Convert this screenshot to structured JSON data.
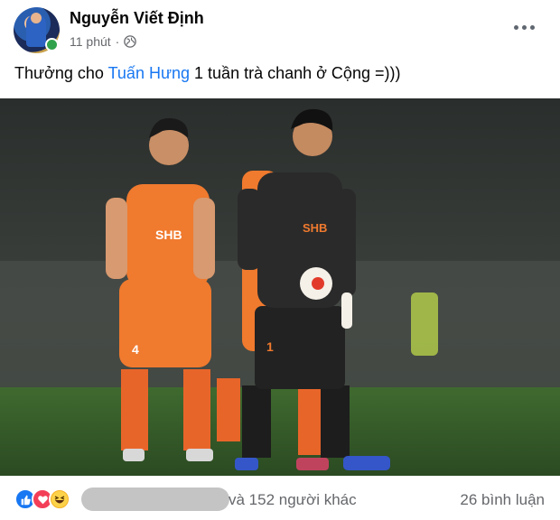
{
  "post": {
    "author": "Nguyễn Viết Định",
    "timestamp": "11 phút",
    "separator": "·",
    "privacy_icon": "globe-icon",
    "more_icon": "more-options-icon",
    "caption": {
      "before": "Thưởng cho ",
      "mention": "Tuấn Hưng",
      "after": " 1 tuần trà chanh ở Cộng =)))"
    },
    "photo": {
      "jersey_text_left": "SHB",
      "jersey_text_right": "SHB",
      "number_left": "4",
      "number_right": "1"
    },
    "footer": {
      "reaction_icons": [
        "like-icon",
        "love-icon",
        "haha-icon"
      ],
      "others_text": "và 152 người khác",
      "comments_text": "26 bình luận"
    }
  },
  "colors": {
    "accent": "#1877f2",
    "online": "#31a24c",
    "secondary_text": "#65676b",
    "orange_kit": "#f07a2e",
    "keeper_kit": "#1f1f1f"
  }
}
